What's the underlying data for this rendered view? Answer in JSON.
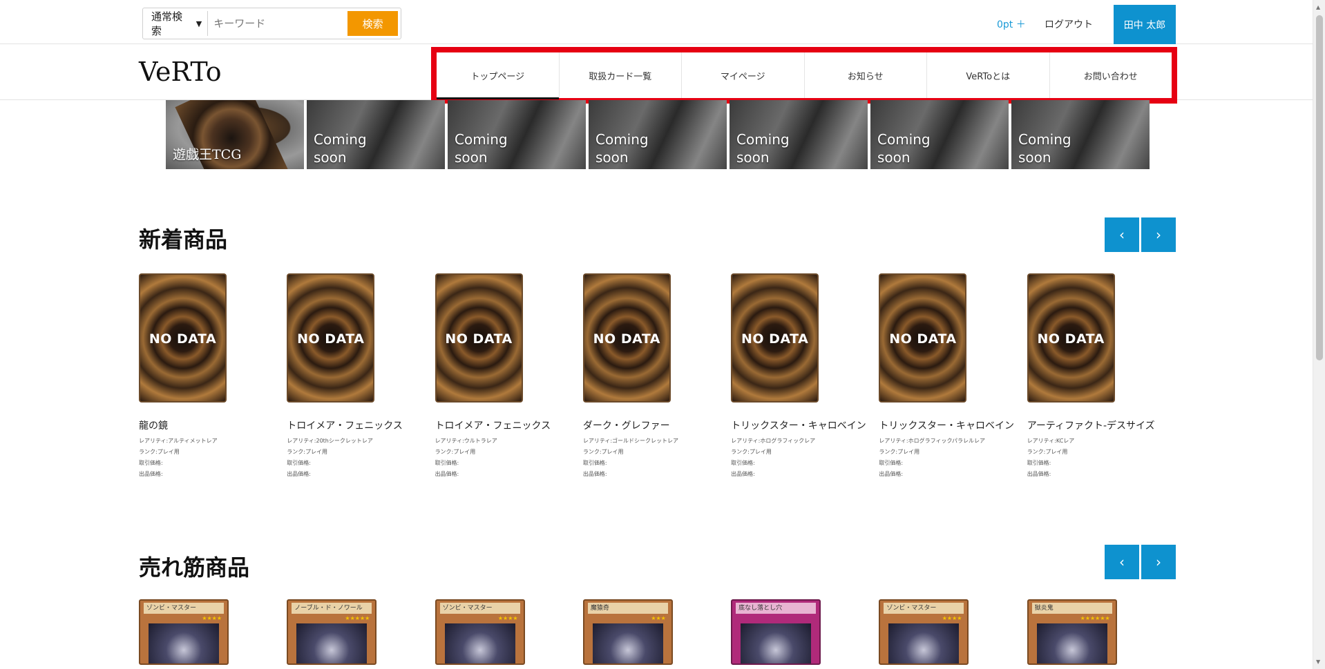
{
  "search": {
    "mode_label": "通常検索",
    "placeholder": "キーワード",
    "button_label": "検索"
  },
  "header": {
    "points": "0pt ＋",
    "logout": "ログアウト",
    "user_name": "田中 太郎",
    "logo": "VeRTo"
  },
  "nav": {
    "items": [
      {
        "label": "トップページ"
      },
      {
        "label": "取扱カード一覧"
      },
      {
        "label": "マイページ"
      },
      {
        "label": "お知らせ"
      },
      {
        "label": "VeRToとは"
      },
      {
        "label": "お問い合わせ"
      }
    ],
    "active_index": 0
  },
  "banners": [
    {
      "label": "遊戯王TCG"
    },
    {
      "label": "Coming\nsoon"
    },
    {
      "label": "Coming\nsoon"
    },
    {
      "label": "Coming\nsoon"
    },
    {
      "label": "Coming\nsoon"
    },
    {
      "label": "Coming\nsoon"
    },
    {
      "label": "Coming\nsoon"
    }
  ],
  "new_section": {
    "title": "新着商品",
    "prev": "‹",
    "next": "›",
    "products": [
      {
        "image_label": "NO DATA",
        "name": "龍の鏡",
        "rarity": "レアリティ:アルティメットレア",
        "condition": "ランク:プレイ用",
        "buy_price": "取引価格:",
        "sell_price": "出品価格:"
      },
      {
        "image_label": "NO DATA",
        "name": "トロイメア・フェニックス",
        "rarity": "レアリティ:20thシークレットレア",
        "condition": "ランク:プレイ用",
        "buy_price": "取引価格:",
        "sell_price": "出品価格:"
      },
      {
        "image_label": "NO DATA",
        "name": "トロイメア・フェニックス",
        "rarity": "レアリティ:ウルトラレア",
        "condition": "ランク:プレイ用",
        "buy_price": "取引価格:",
        "sell_price": "出品価格:"
      },
      {
        "image_label": "NO DATA",
        "name": "ダーク・グレファー",
        "rarity": "レアリティ:ゴールドシークレットレア",
        "condition": "ランク:プレイ用",
        "buy_price": "取引価格:",
        "sell_price": "出品価格:"
      },
      {
        "image_label": "NO DATA",
        "name": "トリックスター・キャロベイン",
        "rarity": "レアリティ:ホログラフィックレア",
        "condition": "ランク:プレイ用",
        "buy_price": "取引価格:",
        "sell_price": "出品価格:"
      },
      {
        "image_label": "NO DATA",
        "name": "トリックスター・キャロベイン",
        "rarity": "レアリティ:ホログラフィックパラレルレア",
        "condition": "ランク:プレイ用",
        "buy_price": "取引価格:",
        "sell_price": "出品価格:"
      },
      {
        "image_label": "NO DATA",
        "name": "アーティファクト-デスサイズ",
        "rarity": "レアリティ:KCレア",
        "condition": "ランク:プレイ用",
        "buy_price": "取引価格:",
        "sell_price": "出品価格:"
      }
    ]
  },
  "best_section": {
    "title": "売れ筋商品",
    "prev": "‹",
    "next": "›",
    "products": [
      {
        "card_title": "ゾンビ・マスター",
        "stars": "★★★★"
      },
      {
        "card_title": "ノーブル・ド・ノワール",
        "stars": "★★★★★"
      },
      {
        "card_title": "ゾンビ・マスター",
        "stars": "★★★★"
      },
      {
        "card_title": "魔猿奇",
        "stars": "★★★"
      },
      {
        "card_title": "底なし落とし穴",
        "stars": ""
      },
      {
        "card_title": "ゾンビ・マスター",
        "stars": "★★★★"
      },
      {
        "card_title": "獄炎鬼",
        "stars": "★★★★★★"
      }
    ]
  }
}
